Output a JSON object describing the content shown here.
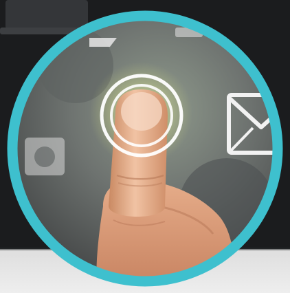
{
  "image": {
    "subject": "finger-touching-circular-button",
    "colors": {
      "backdrop_dark": "#1b1c1e",
      "floor_light": "#e3e3e3",
      "ring_teal": "#3ec0ce",
      "skin": "#e9b090",
      "glow": "#dfe6a8",
      "icon_white": "#f2f2f2"
    },
    "icons": [
      "laptop-icon",
      "mail-envelope-icon",
      "camera-icon",
      "touch-target-icon"
    ]
  }
}
